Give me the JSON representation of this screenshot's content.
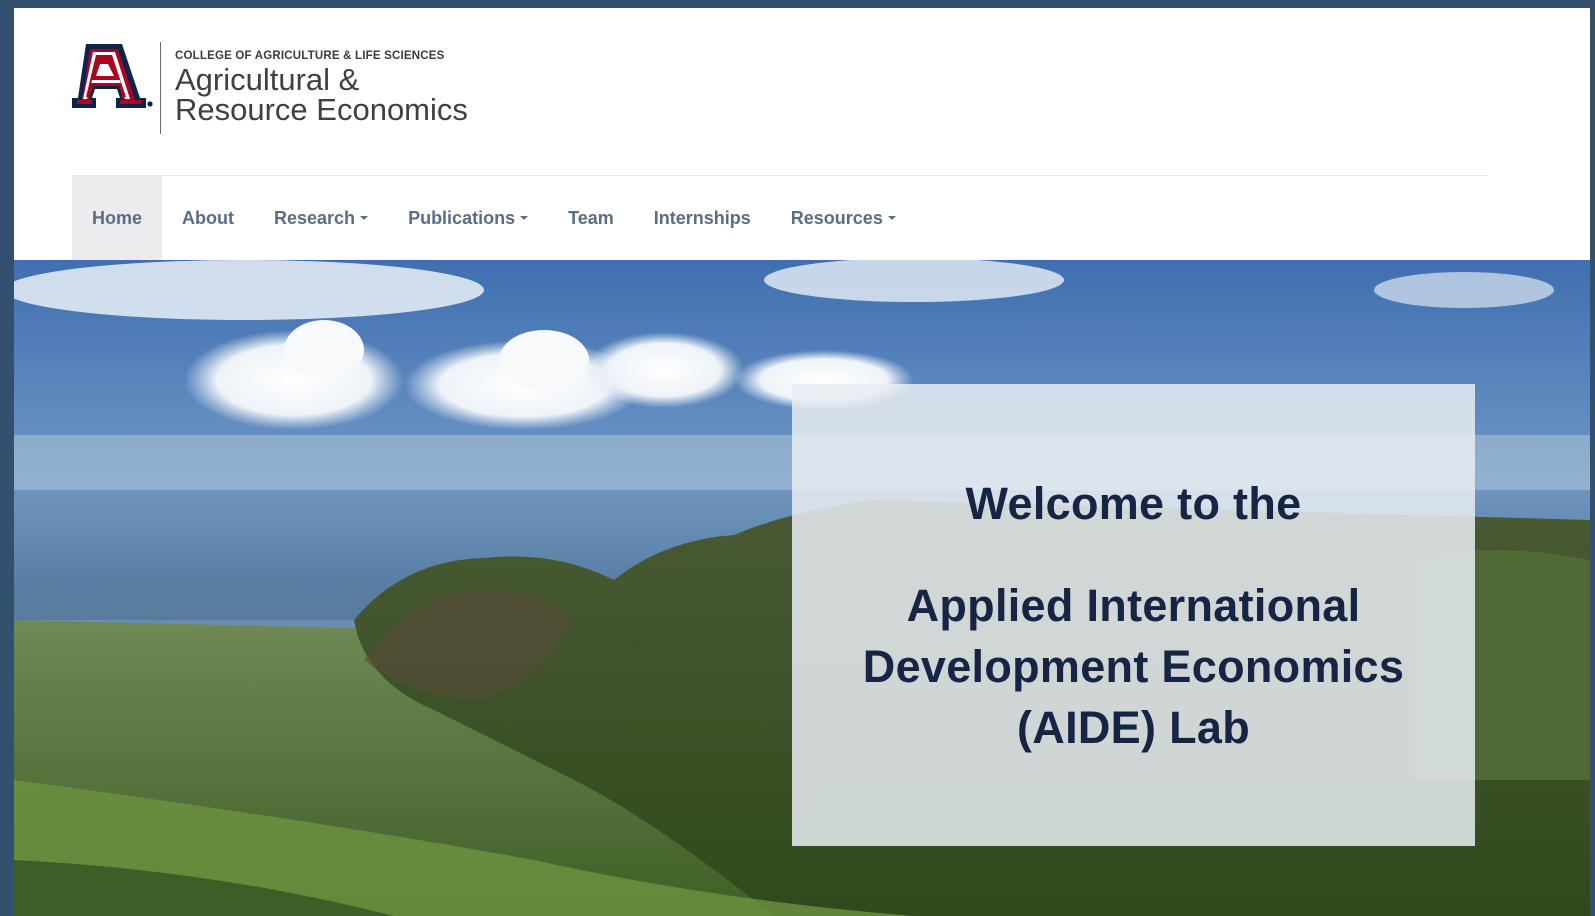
{
  "header": {
    "college": "COLLEGE OF AGRICULTURE & LIFE SCIENCES",
    "dept_line1": "Agricultural &",
    "dept_line2": "Resource Economics",
    "logo_icon": "university-a-logo"
  },
  "nav": {
    "items": [
      {
        "label": "Home",
        "active": true,
        "dropdown": false
      },
      {
        "label": "About",
        "active": false,
        "dropdown": false
      },
      {
        "label": "Research",
        "active": false,
        "dropdown": true
      },
      {
        "label": "Publications",
        "active": false,
        "dropdown": true
      },
      {
        "label": "Team",
        "active": false,
        "dropdown": false
      },
      {
        "label": "Internships",
        "active": false,
        "dropdown": false
      },
      {
        "label": "Resources",
        "active": false,
        "dropdown": true
      }
    ]
  },
  "hero": {
    "welcome_line1": "Welcome to the",
    "welcome_line2a": "Applied International",
    "welcome_line2b": "Development Economics",
    "welcome_line2c": "(AIDE) Lab",
    "image": "mountain-landscape-photo"
  },
  "colors": {
    "frame_bg": "#33506f",
    "nav_text": "#5b6d85",
    "active_bg": "#ececee",
    "heading": "#172544",
    "ua_red": "#ab0520",
    "ua_navy": "#0c234b"
  }
}
